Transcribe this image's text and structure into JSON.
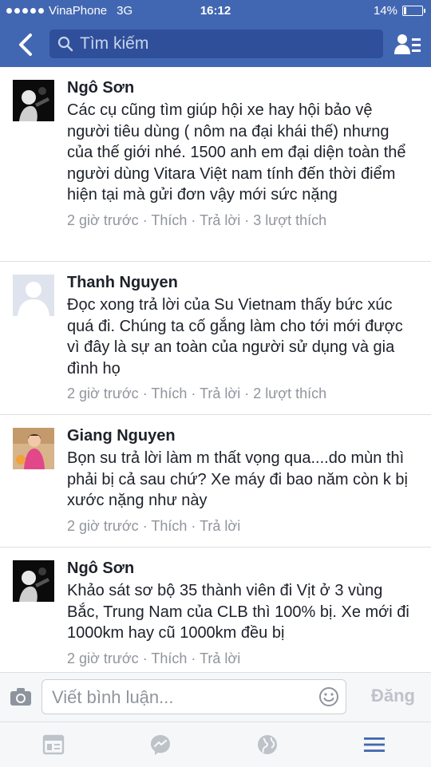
{
  "status_bar": {
    "carrier": "VinaPhone",
    "network": "3G",
    "time": "16:12",
    "battery_text": "14%",
    "battery_level": 0.14
  },
  "nav": {
    "search_placeholder": "Tìm kiếm"
  },
  "comments": [
    {
      "author": "Ngô Sơn",
      "text": "Các cụ cũng tìm giúp hội xe hay hội bảo vệ người tiêu dùng ( nôm na đại khái thế) nhưng của thế giới nhé. 1500 anh em đại diện toàn thể người dùng Vitara Việt nam tính đến thời điểm hiện tại mà gửi đơn vậy mới sức nặng",
      "time": "2 giờ trước",
      "like": "Thích",
      "reply": "Trả lời",
      "likes": "3 lượt thích"
    },
    {
      "author": "Thanh Nguyen",
      "text": "Đọc xong trả lời của Su Vietnam thấy bức xúc quá đi. Chúng ta cố gắng làm cho tới mới được vì đây là sự an toàn của người sử dụng và gia đình họ",
      "time": "2 giờ trước",
      "like": "Thích",
      "reply": "Trả lời",
      "likes": "2 lượt thích"
    },
    {
      "author": "Giang Nguyen",
      "text": "Bọn su trả lời làm m thất vọng qua....do mùn thì phải bị cả sau chứ? Xe máy đi bao năm còn k bị xước nặng như này",
      "time": "2 giờ trước",
      "like": "Thích",
      "reply": "Trả lời",
      "likes": ""
    },
    {
      "author": "Ngô Sơn",
      "text": "Khảo sát sơ bộ 35 thành viên đi Vịt ở 3 vùng Bắc, Trung Nam của CLB thì 100% bị. Xe mới đi 1000km hay cũ 1000km đều bị",
      "time": "2 giờ trước",
      "like": "Thích",
      "reply": "Trả lời",
      "likes": ""
    }
  ],
  "composer": {
    "placeholder": "Viết bình luận...",
    "post_label": "Đăng"
  },
  "tabbar": {
    "tabs": [
      "news-feed-icon",
      "messenger-icon",
      "globe-icon",
      "menu-icon"
    ],
    "active_color": "#4267b2",
    "inactive_color": "#bec3c9"
  },
  "colors": {
    "header": "#4267b2",
    "meta_text": "#90949c"
  }
}
